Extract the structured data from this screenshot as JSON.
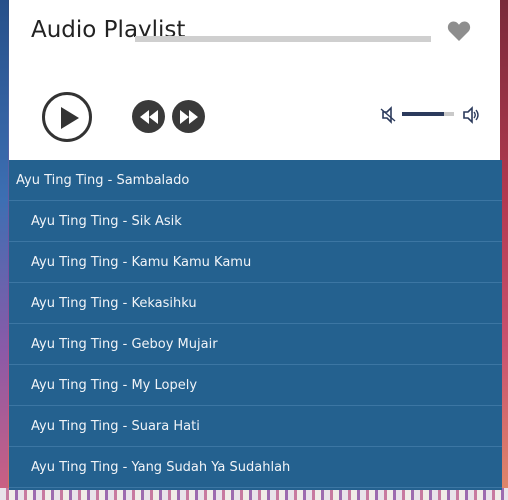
{
  "player": {
    "title": "Audio Playlist",
    "progress_fraction": 0,
    "volume_fraction": 0.8,
    "favorited": false
  },
  "icons": {
    "favorite": "heart-icon",
    "play": "play-icon",
    "previous": "rewind-icon",
    "next": "fast-forward-icon",
    "volume_down": "volume-low-icon",
    "volume_up": "volume-high-icon"
  },
  "colors": {
    "playlist_bg": "#24618f",
    "item_text": "#f1f4f8",
    "volume_fill": "#2b3a5c"
  },
  "playlist": {
    "active_index": 0,
    "items": [
      "Ayu Ting Ting - Sambalado",
      "Ayu Ting Ting - Sik Asik",
      "Ayu Ting Ting - Kamu Kamu Kamu",
      "Ayu Ting Ting - Kekasihku",
      "Ayu Ting Ting - Geboy Mujair",
      "Ayu Ting Ting - My Lopely",
      "Ayu Ting Ting - Suara Hati",
      "Ayu Ting Ting - Yang Sudah Ya Sudahlah"
    ]
  }
}
